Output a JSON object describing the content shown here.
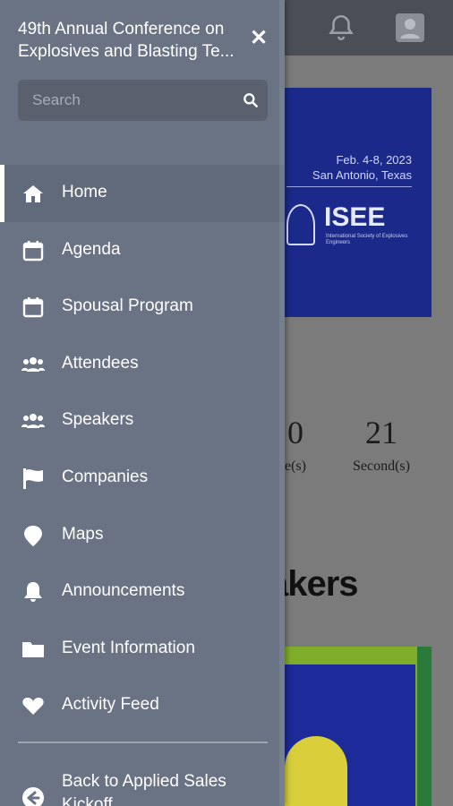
{
  "background": {
    "banner": {
      "date_line1": "Feb. 4-8, 2023",
      "date_line2": "San Antonio, Texas",
      "logo_text": "ISEE",
      "logo_sub": "International Society of Explosives Engineers"
    },
    "countdown": [
      {
        "value": "0",
        "label": "e(s)"
      },
      {
        "value": "21",
        "label": "Second(s)"
      }
    ],
    "speakers_heading": "akers"
  },
  "drawer": {
    "title_line1": "49th Annual Conference on",
    "title_line2": "Explosives and Blasting Te...",
    "search": {
      "placeholder": "Search",
      "value": ""
    },
    "menu": [
      {
        "label": "Home",
        "icon": "home-icon",
        "active": true
      },
      {
        "label": "Agenda",
        "icon": "calendar-icon"
      },
      {
        "label": "Spousal Program",
        "icon": "calendar-icon"
      },
      {
        "label": "Attendees",
        "icon": "users-icon"
      },
      {
        "label": "Speakers",
        "icon": "users-icon"
      },
      {
        "label": "Companies",
        "icon": "flag-icon"
      },
      {
        "label": "Maps",
        "icon": "map-pin-icon"
      },
      {
        "label": "Announcements",
        "icon": "bell-icon"
      },
      {
        "label": "Event Information",
        "icon": "folder-icon"
      },
      {
        "label": "Activity Feed",
        "icon": "heart-icon"
      }
    ],
    "back_label": "Back to Applied Sales Kickoff"
  },
  "colors": {
    "drawer_bg": "#6a7384",
    "active_bg": "#606a7a",
    "search_bg": "#59616f",
    "banner_bg": "#1b2a8a"
  }
}
